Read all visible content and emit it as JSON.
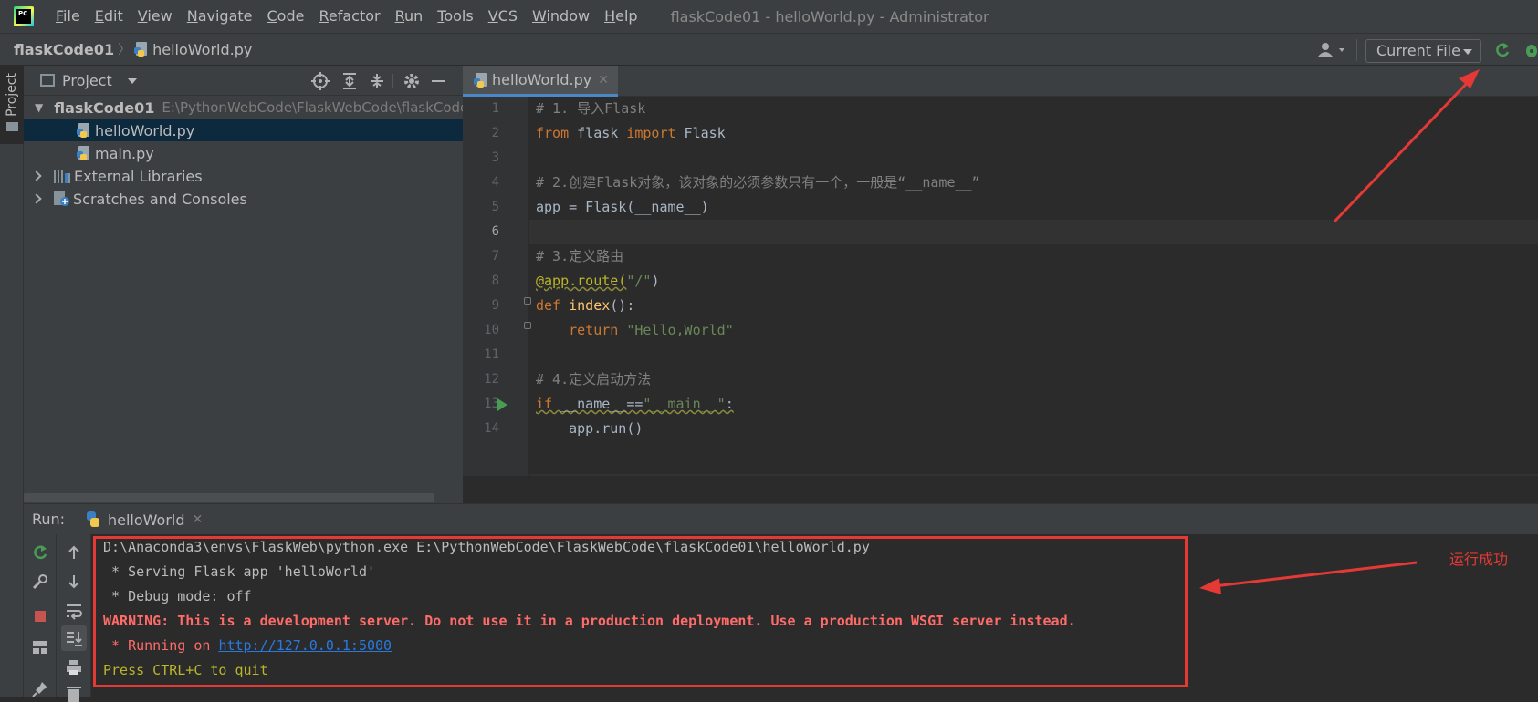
{
  "app": {
    "logo_text": "PC",
    "window_title": "flaskCode01 - helloWorld.py - Administrator",
    "menu": [
      "File",
      "Edit",
      "View",
      "Navigate",
      "Code",
      "Refactor",
      "Run",
      "Tools",
      "VCS",
      "Window",
      "Help"
    ]
  },
  "navbar": {
    "project": "flaskCode01",
    "file": "helloWorld.py",
    "run_config": "Current File"
  },
  "project_panel": {
    "title": "Project",
    "side_tab": "Project",
    "root_name": "flaskCode01",
    "root_path": "E:\\PythonWebCode\\FlaskWebCode\\flaskCode",
    "files": [
      "helloWorld.py",
      "main.py"
    ],
    "external": "External Libraries",
    "scratches": "Scratches and Consoles"
  },
  "editor": {
    "tab": "helloWorld.py",
    "line_numbers": [
      "1",
      "2",
      "3",
      "4",
      "5",
      "6",
      "7",
      "8",
      "9",
      "10",
      "11",
      "12",
      "13",
      "14"
    ],
    "lines": {
      "l1": "# 1. 导入Flask",
      "l2a": "from",
      "l2b": " flask ",
      "l2c": "import",
      "l2d": " Flask",
      "l4": "# 2.创建Flask对象，该对象的必须参数只有一个，一般是“__name__”",
      "l5": "app = Flask(__name__)",
      "l7": "# 3.定义路由",
      "l8a": "@app.route(",
      "l8b": "\"/\"",
      "l8c": ")",
      "l9a": "def",
      "l9b": " index",
      "l9c": "():",
      "l10a": "    return ",
      "l10b": "\"Hello,World\"",
      "l12": "# 4.定义启动方法",
      "l13a": "if",
      "l13b": " __name__==",
      "l13c": "\"__main__\"",
      "l13d": ":",
      "l14": "    app.run()"
    }
  },
  "run": {
    "label": "Run:",
    "tab": "helloWorld",
    "console": {
      "c1": "D:\\Anaconda3\\envs\\FlaskWeb\\python.exe E:\\PythonWebCode\\FlaskWebCode\\flaskCode01\\helloWorld.py",
      "c2": " * Serving Flask app 'helloWorld'",
      "c3": " * Debug mode: off",
      "c4": "WARNING: This is a development server. Do not use it in a production deployment. Use a production WSGI server instead.",
      "c5a": " * Running on ",
      "c5b": "http://127.0.0.1:5000",
      "c6": "Press CTRL+C to quit"
    }
  },
  "annotation": {
    "text": "运行成功"
  },
  "colors": {
    "accent": "#4a88c7",
    "annotation_red": "#e53935",
    "warning_red": "#ff6b68",
    "link": "#287bde"
  }
}
